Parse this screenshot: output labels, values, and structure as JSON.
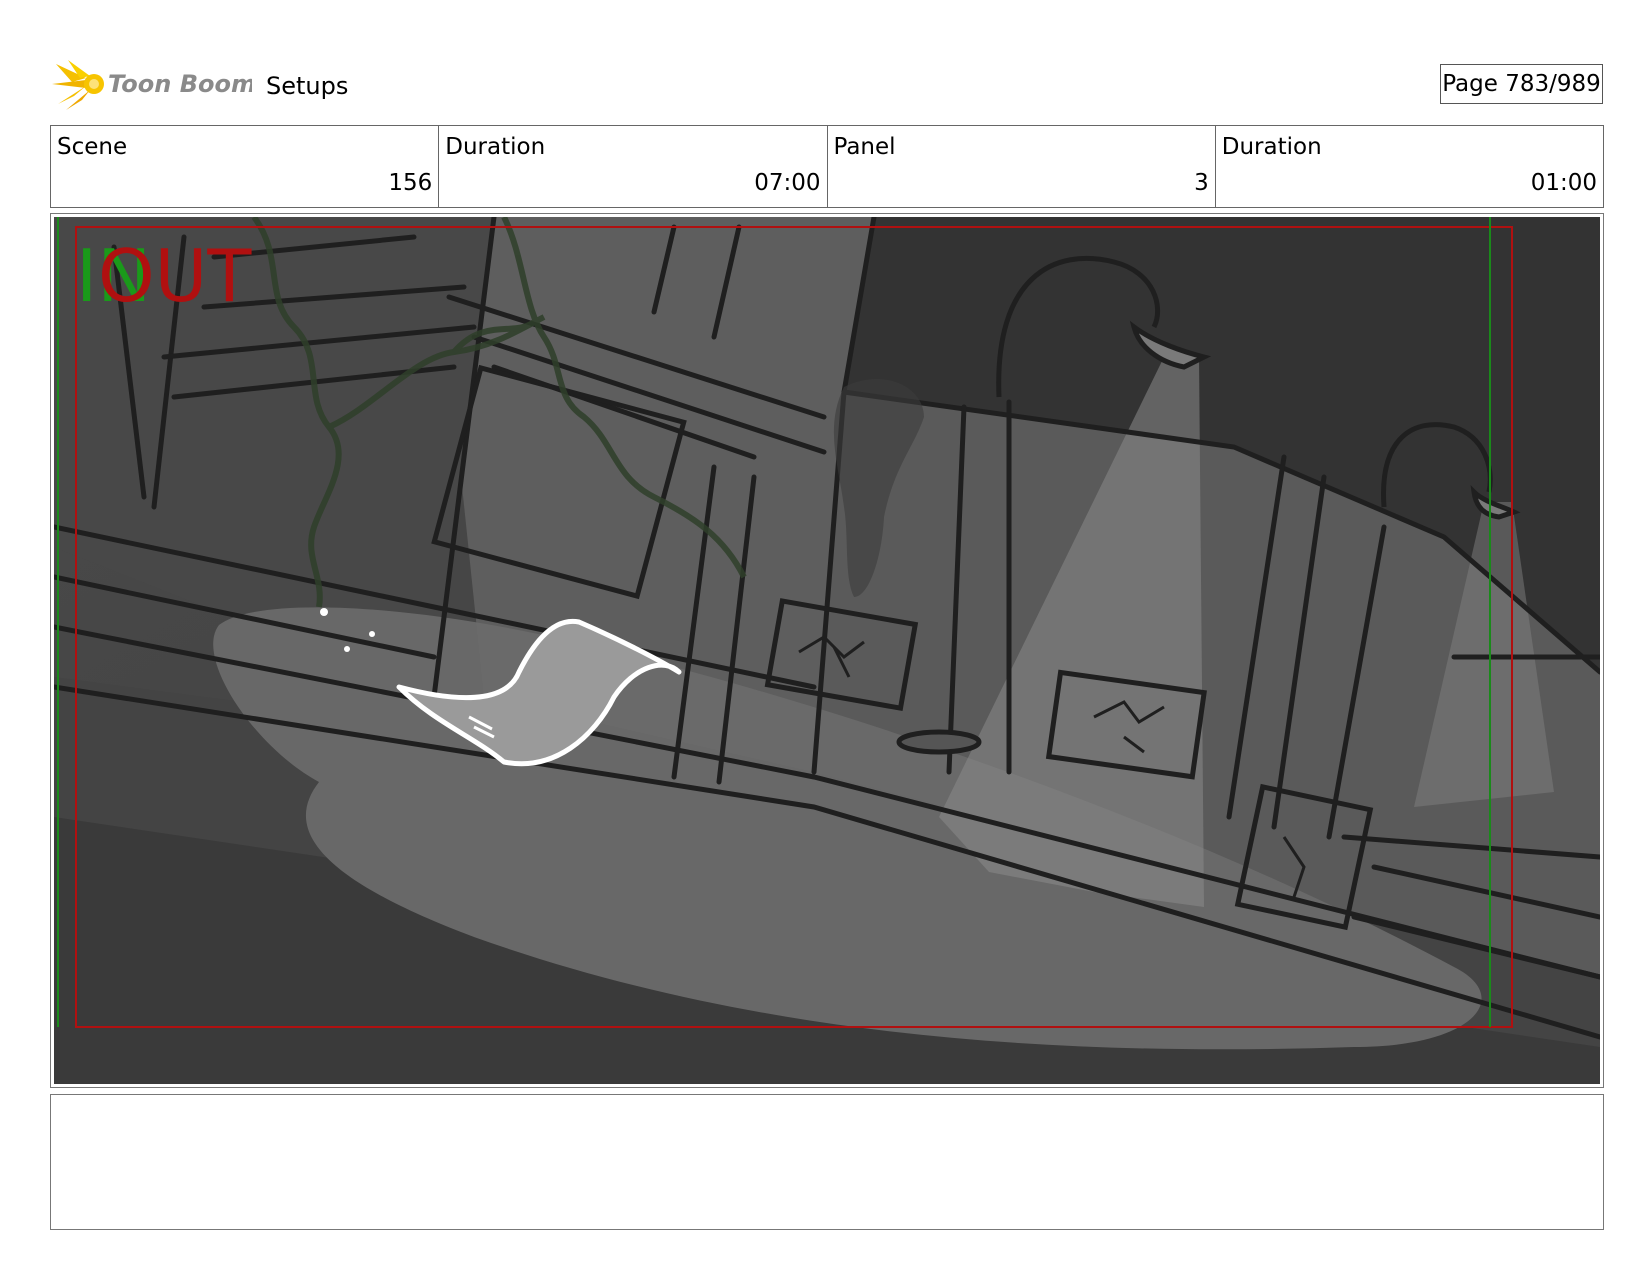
{
  "header": {
    "logo_text": "Toon Boom",
    "project": "Setups",
    "page_label": "Page 783/989"
  },
  "info": {
    "scene_label": "Scene",
    "scene_value": "156",
    "scene_duration_label": "Duration",
    "scene_duration_value": "07:00",
    "panel_label": "Panel",
    "panel_value": "3",
    "panel_duration_label": "Duration",
    "panel_duration_value": "01:00"
  },
  "panel_overlay": {
    "in_label": "IN",
    "out_label": "OUT"
  },
  "notes": {
    "text": ""
  },
  "colors": {
    "in_marker": "#1a9a1a",
    "out_marker": "#b01010",
    "safe_frame_red": "#b01010",
    "safe_frame_green": "#1a8a1a"
  }
}
